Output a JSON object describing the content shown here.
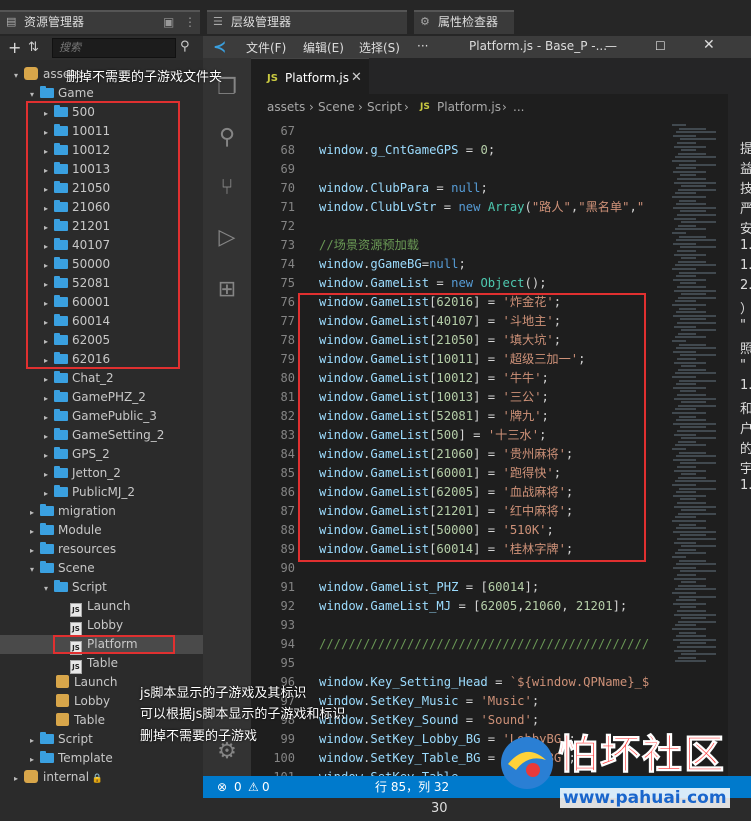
{
  "tabs": {
    "assets": "资源管理器",
    "hierarchy": "层级管理器",
    "inspector": "属性检查器"
  },
  "assets_panel": {
    "search_placeholder": "搜索",
    "root": "assets",
    "game": "Game",
    "subgames": [
      "500",
      "10011",
      "10012",
      "10013",
      "21050",
      "21060",
      "21201",
      "40107",
      "50000",
      "52081",
      "60001",
      "60014",
      "62005",
      "62016"
    ],
    "game_others": [
      "Chat_2",
      "GamePHZ_2",
      "GamePublic_3",
      "GameSetting_2",
      "GPS_2",
      "Jetton_2",
      "PublicMJ_2"
    ],
    "top_folders": [
      "migration",
      "Module",
      "resources"
    ],
    "scene": "Scene",
    "script": "Script",
    "script_files": [
      "Launch",
      "Lobby",
      "Platform",
      "Table"
    ],
    "scenes": [
      "Launch",
      "Lobby",
      "Table"
    ],
    "after": [
      "Script",
      "Template"
    ],
    "internal": "internal"
  },
  "vscode": {
    "menu": [
      "文件(F)",
      "编辑(E)",
      "选择(S)",
      "···"
    ],
    "title": "Platform.js - Base_P -...",
    "tab": "Platform.js",
    "breadcrumb": [
      "assets",
      "Scene",
      "Script",
      "Platform.js",
      "..."
    ],
    "status_errors": "0",
    "status_warnings": "0",
    "status_position": "行 85，列 32"
  },
  "code_lines": [
    {
      "n": "67",
      "t": ""
    },
    {
      "n": "68",
      "t": "window.g_CntGameGPS = 0;"
    },
    {
      "n": "69",
      "t": ""
    },
    {
      "n": "70",
      "t": "window.ClubPara = null;"
    },
    {
      "n": "71",
      "t": "window.ClubLvStr = new Array(\"路人\",\"黑名单\",\""
    },
    {
      "n": "72",
      "t": ""
    },
    {
      "n": "73",
      "t": "//场景资源预加载"
    },
    {
      "n": "74",
      "t": "window.gGameBG=null;"
    },
    {
      "n": "75",
      "t": "window.GameList = new Object();"
    },
    {
      "n": "76",
      "t": "window.GameList[62016] = '炸金花';"
    },
    {
      "n": "77",
      "t": "window.GameList[40107] = '斗地主';"
    },
    {
      "n": "78",
      "t": "window.GameList[21050] = '填大坑';"
    },
    {
      "n": "79",
      "t": "window.GameList[10011] = '超级三加一';"
    },
    {
      "n": "80",
      "t": "window.GameList[10012] = '牛牛';"
    },
    {
      "n": "81",
      "t": "window.GameList[10013] = '三公';"
    },
    {
      "n": "82",
      "t": "window.GameList[52081] = '牌九';"
    },
    {
      "n": "83",
      "t": "window.GameList[500] = '十三水';"
    },
    {
      "n": "84",
      "t": "window.GameList[21060] = '贵州麻将';"
    },
    {
      "n": "85",
      "t": "window.GameList[60001] = '跑得快';"
    },
    {
      "n": "86",
      "t": "window.GameList[62005] = '血战麻将';"
    },
    {
      "n": "87",
      "t": "window.GameList[21201] = '红中麻将';"
    },
    {
      "n": "88",
      "t": "window.GameList[50000] = '510K';"
    },
    {
      "n": "89",
      "t": "window.GameList[60014] = '桂林字牌';"
    },
    {
      "n": "90",
      "t": ""
    },
    {
      "n": "91",
      "t": "window.GameList_PHZ = [60014];"
    },
    {
      "n": "92",
      "t": "window.GameList_MJ = [62005,21060, 21201];"
    },
    {
      "n": "93",
      "t": ""
    },
    {
      "n": "94",
      "t": "/////////////////////////////////////////////"
    },
    {
      "n": "95",
      "t": ""
    },
    {
      "n": "96",
      "t": "window.Key_Setting_Head = `${window.QPName}_$"
    },
    {
      "n": "97",
      "t": "window.SetKey_Music = 'Music';"
    },
    {
      "n": "98",
      "t": "window.SetKey_Sound = 'Sound';"
    },
    {
      "n": "99",
      "t": "window.SetKey_Lobby_BG = 'LobbyBG';"
    },
    {
      "n": "100",
      "t": "window.SetKey_Table_BG = 'TableBG';"
    },
    {
      "n": "101",
      "t": "window.SetKey_Table"
    }
  ],
  "annotations": {
    "top": "删掉不需要的子游戏文件夹",
    "bottom1": "js脚本显示的子游戏及其标识",
    "bottom2": "可以根据js脚本显示的子游戏和标识",
    "bottom3": "删掉不需要的子游戏"
  },
  "watermark": {
    "name": "怕坏社区",
    "url": "www.pahuai.com"
  },
  "right_strip_texts": [
    "提",
    "益",
    "技",
    "严",
    "安",
    "1.",
    "1.",
    "2.",
    "）",
    "\"",
    "照",
    "\"",
    "1.",
    "和",
    "户",
    "的",
    "宇",
    "1."
  ],
  "bottom_number": "30"
}
